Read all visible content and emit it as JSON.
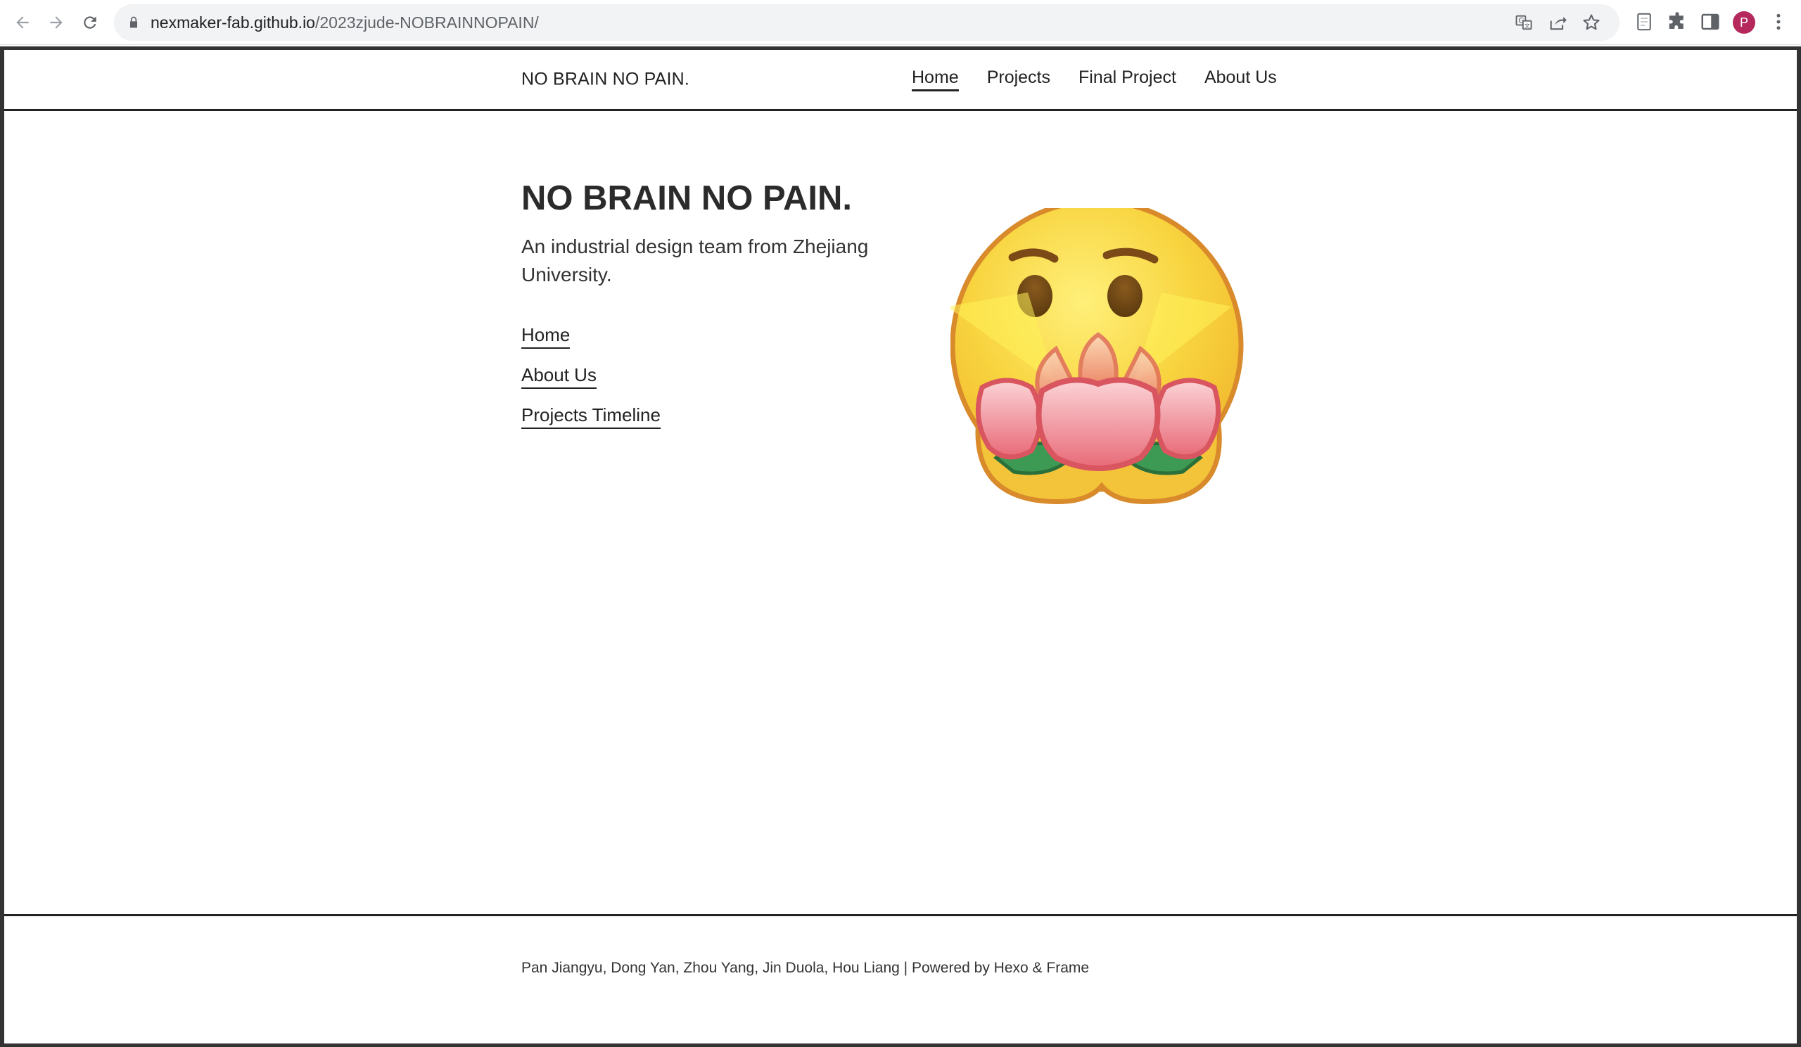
{
  "browser": {
    "url_host": "nexmaker-fab.github.io",
    "url_path": "/2023zjude-NOBRAINNOPAIN/",
    "profile_initial": "P",
    "icons": [
      "back-icon",
      "forward-icon",
      "reload-icon",
      "lock-icon",
      "translate-icon",
      "share-icon",
      "star-icon",
      "reading-list-icon",
      "extensions-icon",
      "side-panel-icon",
      "menu-icon"
    ]
  },
  "header": {
    "brand": "NO BRAIN NO PAIN.",
    "nav": [
      {
        "label": "Home",
        "active": true
      },
      {
        "label": "Projects",
        "active": false
      },
      {
        "label": "Final Project",
        "active": false
      },
      {
        "label": "About Us",
        "active": false
      }
    ]
  },
  "hero": {
    "title": "NO BRAIN NO PAIN.",
    "subtitle": "An industrial design team from Zhejiang University.",
    "links": [
      "Home",
      "About Us",
      "Projects Timeline"
    ]
  },
  "footer": {
    "text": "Pan Jiangyu, Dong Yan, Zhou Yang, Jin Duola, Hou Liang | Powered by Hexo & Frame"
  },
  "colors": {
    "text": "#222222",
    "border": "#333333",
    "emoji_face": "#f6c93b",
    "emoji_outline": "#d98a2b",
    "lotus_pink": "#ef8e98",
    "lotus_leaf": "#3c9a55",
    "avatar": "#b5285c"
  }
}
